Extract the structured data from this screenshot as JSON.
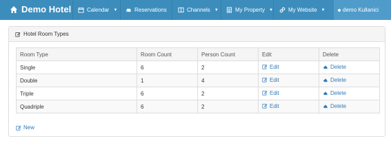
{
  "navbar": {
    "brand": "Demo Hotel",
    "items": [
      {
        "label": "Calendar",
        "icon": "calendar-icon",
        "dropdown": true
      },
      {
        "label": "Reservations",
        "icon": "car-icon",
        "dropdown": false
      },
      {
        "label": "Channels",
        "icon": "window-icon",
        "dropdown": true
      },
      {
        "label": "My Property",
        "icon": "list-icon",
        "dropdown": true
      },
      {
        "label": "My Website",
        "icon": "link-icon",
        "dropdown": true
      }
    ],
    "user": "demo Kullanici"
  },
  "panel": {
    "title": "Hotel Room Types"
  },
  "table": {
    "headers": [
      "Room Type",
      "Room Count",
      "Person Count",
      "Edit",
      "Delete"
    ],
    "rows": [
      {
        "type": "Single",
        "room_count": "6",
        "person_count": "2",
        "edit": "Edit",
        "delete": "Delete"
      },
      {
        "type": "Double",
        "room_count": "1",
        "person_count": "4",
        "edit": "Edit",
        "delete": "Delete"
      },
      {
        "type": "Triple",
        "room_count": "6",
        "person_count": "2",
        "edit": "Edit",
        "delete": "Delete"
      },
      {
        "type": "Quadriple",
        "room_count": "6",
        "person_count": "2",
        "edit": "Edit",
        "delete": "Delete"
      }
    ]
  },
  "footer": {
    "new_label": "New"
  },
  "colors": {
    "navbar": "#3c8dbc",
    "link": "#337ab7"
  }
}
